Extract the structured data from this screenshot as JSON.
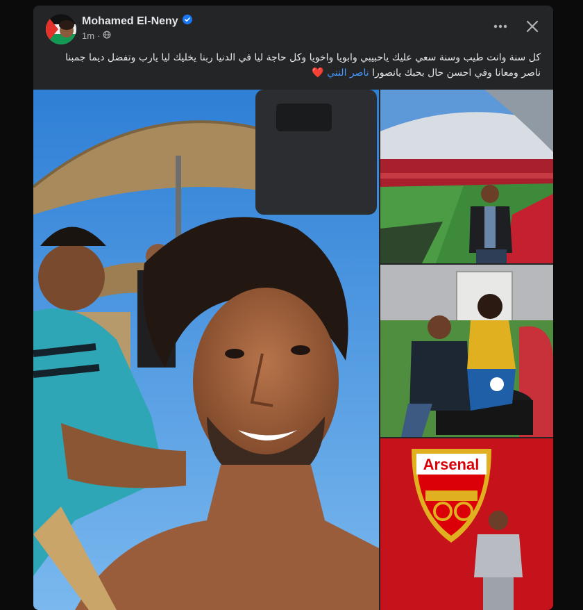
{
  "post": {
    "author": "Mohamed El-Neny",
    "time": "1m",
    "caption_main": "كل سنة وانت طيب وسنة سعي عليك ياحبيبي وابويا واخويا وكل حاجة ليا في الدنيا ربنا يخليك ليا يارب وتفضل ديما جمبنا  ناصر ومعانا وفي احسن حال  بحبك يانصورا ",
    "mention": "ناصر النني",
    "heart": "❤️"
  },
  "photos": {
    "main_alt": "Beach selfie",
    "stadium_alt": "Stadium photo",
    "statue_alt": "Statue photo",
    "crest_text": "Arsenal"
  },
  "colors": {
    "card_bg": "#242526",
    "link": "#4599ff",
    "verified": "#1877f2",
    "crest_red": "#db0007"
  },
  "icons": {
    "more": "more-icon",
    "close": "close-icon",
    "verified": "verified-badge-icon",
    "audience": "globe-icon"
  }
}
